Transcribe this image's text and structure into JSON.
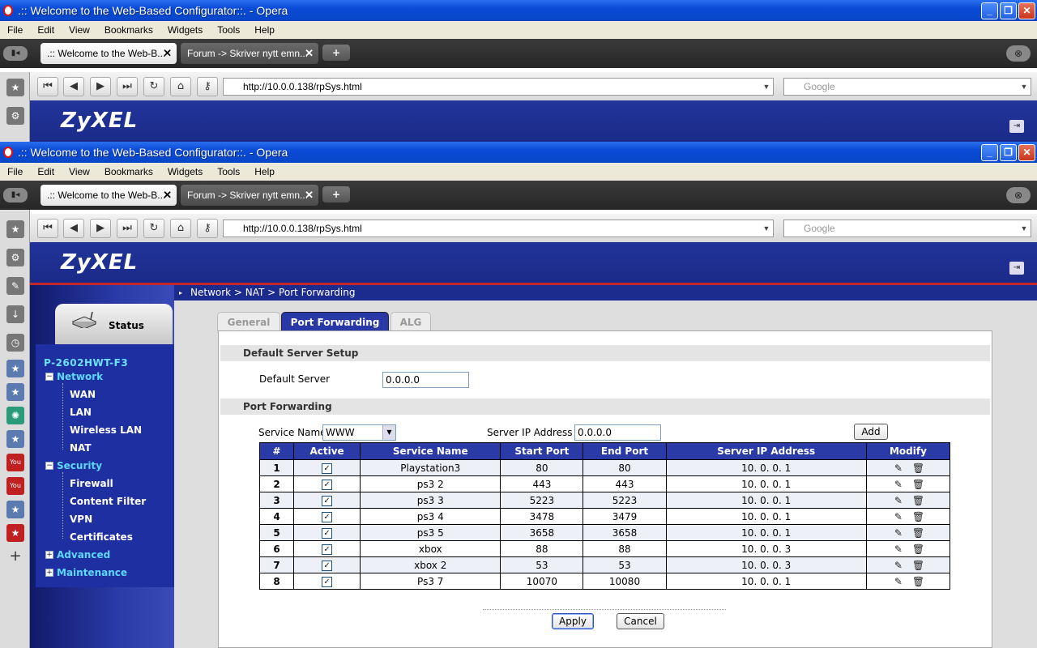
{
  "window": {
    "title": ".:: Welcome to the Web-Based Configurator::. - Opera",
    "min": "_",
    "max": "❐",
    "close": "✕"
  },
  "menu": [
    "File",
    "Edit",
    "View",
    "Bookmarks",
    "Widgets",
    "Tools",
    "Help"
  ],
  "tabs": [
    {
      "label": ".:: Welcome to the Web-B...",
      "close": "✕"
    },
    {
      "label": "Forum -> Skriver nytt emn...",
      "close": "✕"
    }
  ],
  "address": {
    "url": "http://10.0.0.138/rpSys.html",
    "search_placeholder": "Google"
  },
  "brand": "ZyXEL",
  "breadcrumb": "Network > NAT > Port Forwarding",
  "nav": {
    "status": "Status",
    "device": "P-2602HWT-F3",
    "network": "Network",
    "wan": "WAN",
    "lan": "LAN",
    "wireless": "Wireless LAN",
    "nat": "NAT",
    "security": "Security",
    "firewall": "Firewall",
    "content_filter": "Content Filter",
    "vpn": "VPN",
    "certificates": "Certificates",
    "advanced": "Advanced",
    "maintenance": "Maintenance"
  },
  "content_tabs": {
    "general": "General",
    "port_forwarding": "Port Forwarding",
    "alg": "ALG"
  },
  "default_server": {
    "section": "Default Server Setup",
    "label": "Default Server",
    "value": "0.0.0.0"
  },
  "port_forwarding": {
    "section": "Port Forwarding",
    "service_label": "Service Name",
    "service_value": "WWW",
    "server_ip_label": "Server IP Address",
    "server_ip_value": "0.0.0.0",
    "add": "Add",
    "columns": [
      "#",
      "Active",
      "Service Name",
      "Start Port",
      "End Port",
      "Server IP Address",
      "Modify"
    ],
    "rows": [
      {
        "n": "1",
        "name": "Playstation3",
        "start": "80",
        "end": "80",
        "ip": "10. 0. 0. 1"
      },
      {
        "n": "2",
        "name": "ps3 2",
        "start": "443",
        "end": "443",
        "ip": "10. 0. 0. 1"
      },
      {
        "n": "3",
        "name": "ps3 3",
        "start": "5223",
        "end": "5223",
        "ip": "10. 0. 0. 1"
      },
      {
        "n": "4",
        "name": "ps3 4",
        "start": "3478",
        "end": "3479",
        "ip": "10. 0. 0. 1"
      },
      {
        "n": "5",
        "name": "ps3 5",
        "start": "3658",
        "end": "3658",
        "ip": "10. 0. 0. 1"
      },
      {
        "n": "6",
        "name": "xbox",
        "start": "88",
        "end": "88",
        "ip": "10. 0. 0. 3"
      },
      {
        "n": "7",
        "name": "xbox 2",
        "start": "53",
        "end": "53",
        "ip": "10. 0. 0. 3"
      },
      {
        "n": "8",
        "name": "Ps3 7",
        "start": "10070",
        "end": "10080",
        "ip": "10. 0. 0. 1"
      }
    ]
  },
  "buttons": {
    "apply": "Apply",
    "cancel": "Cancel"
  },
  "colors": {
    "header": "#1a2a88",
    "table_header": "#2a3aa6",
    "accent_red": "#c0282c",
    "nav_text": "#5fd8ff"
  }
}
